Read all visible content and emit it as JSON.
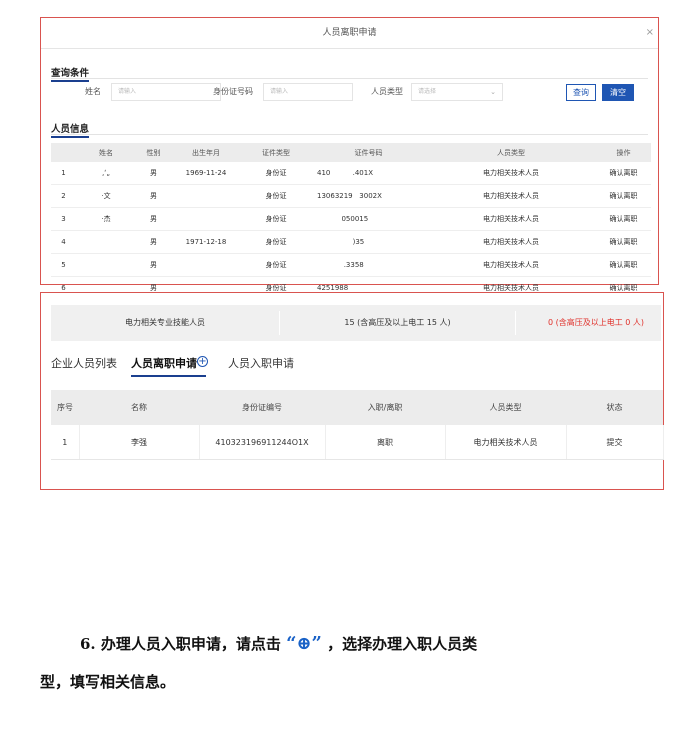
{
  "dialog": {
    "title": "人员离职申请",
    "close": "×"
  },
  "query": {
    "section_title": "查询条件",
    "name_label": "姓名",
    "name_placeholder": "请输入",
    "id_label": "身份证号码",
    "id_placeholder": "请输入",
    "type_label": "人员类型",
    "type_placeholder": "请选择",
    "query_button": "查询",
    "clear_button": "清空"
  },
  "staff_info": {
    "section_title": "人员信息",
    "headers": [
      "",
      "姓名",
      "性别",
      "出生年月",
      "证件类型",
      "证件号码",
      "人员类型",
      "操作"
    ],
    "rows": [
      [
        "1",
        "‚ʻ„",
        "男",
        "1969-11-24",
        "身份证",
        "410          .401X",
        "电力相关技术人员",
        "确认离职"
      ],
      [
        "2",
        "·文",
        "男",
        "",
        "身份证",
        "13063219   3002X",
        "电力相关技术人员",
        "确认离职"
      ],
      [
        "3",
        "·杰",
        "男",
        "",
        "身份证",
        "           050015",
        "电力相关技术人员",
        "确认离职"
      ],
      [
        "4",
        "",
        "男",
        "1971-12-18",
        "身份证",
        "                )35",
        "电力相关技术人员",
        "确认离职"
      ],
      [
        "5",
        "",
        "男",
        "",
        "身份证",
        "            .3358",
        "电力相关技术人员",
        "确认离职"
      ],
      [
        "6",
        "",
        "男",
        "",
        "身份证",
        "4251988      ",
        "电力相关技术人员",
        "确认离职"
      ]
    ]
  },
  "stats": {
    "label": "电力相关专业技能人员",
    "count": "15 (含高压及以上电工 15 人)",
    "zero": "0 (含高压及以上电工 0 人)"
  },
  "tabs": {
    "list": "企业人员列表",
    "leave": "人员离职申请",
    "entry": "人员入职申请",
    "plus": "+"
  },
  "apply_table": {
    "headers": [
      "序号",
      "名称",
      "身份证编号",
      "入职/离职",
      "人员类型",
      "状态"
    ],
    "row": [
      "1",
      "李强",
      "410323196911244O1X",
      "离职",
      "电力相关技术人员",
      "提交"
    ]
  },
  "instruction": {
    "line1_a": "6. 办理人员入职申请，请点击",
    "quote": "“⊕”",
    "line1_b": "，选择办理入职人员类",
    "line2": "型，填写相关信息。"
  }
}
